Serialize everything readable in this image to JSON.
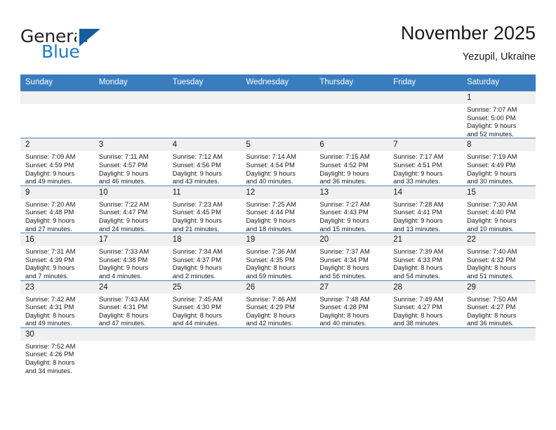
{
  "logo": {
    "text_top": "General",
    "text_bottom": "Blue",
    "icon": "triangle-flag-icon",
    "color_blue": "#1d7cc4",
    "color_dark": "#145d9e"
  },
  "header": {
    "month_title": "November 2025",
    "location": "Yezupil, Ukraine"
  },
  "theme": {
    "header_bg": "#3a7dbf",
    "daynum_bg": "#f0f0f0",
    "grid_line": "#4a86bd",
    "text": "#1a1a1a"
  },
  "weekday_headers": [
    "Sunday",
    "Monday",
    "Tuesday",
    "Wednesday",
    "Thursday",
    "Friday",
    "Saturday"
  ],
  "weeks": [
    [
      {
        "day": "",
        "blank": true,
        "sunrise": "",
        "sunset": "",
        "daylight_1": "",
        "daylight_2": ""
      },
      {
        "day": "",
        "blank": true,
        "sunrise": "",
        "sunset": "",
        "daylight_1": "",
        "daylight_2": ""
      },
      {
        "day": "",
        "blank": true,
        "sunrise": "",
        "sunset": "",
        "daylight_1": "",
        "daylight_2": ""
      },
      {
        "day": "",
        "blank": true,
        "sunrise": "",
        "sunset": "",
        "daylight_1": "",
        "daylight_2": ""
      },
      {
        "day": "",
        "blank": true,
        "sunrise": "",
        "sunset": "",
        "daylight_1": "",
        "daylight_2": ""
      },
      {
        "day": "",
        "blank": true,
        "sunrise": "",
        "sunset": "",
        "daylight_1": "",
        "daylight_2": ""
      },
      {
        "day": "1",
        "blank": false,
        "sunrise": "Sunrise: 7:07 AM",
        "sunset": "Sunset: 5:00 PM",
        "daylight_1": "Daylight: 9 hours",
        "daylight_2": "and 52 minutes."
      }
    ],
    [
      {
        "day": "2",
        "blank": false,
        "sunrise": "Sunrise: 7:09 AM",
        "sunset": "Sunset: 4:59 PM",
        "daylight_1": "Daylight: 9 hours",
        "daylight_2": "and 49 minutes."
      },
      {
        "day": "3",
        "blank": false,
        "sunrise": "Sunrise: 7:11 AM",
        "sunset": "Sunset: 4:57 PM",
        "daylight_1": "Daylight: 9 hours",
        "daylight_2": "and 46 minutes."
      },
      {
        "day": "4",
        "blank": false,
        "sunrise": "Sunrise: 7:12 AM",
        "sunset": "Sunset: 4:56 PM",
        "daylight_1": "Daylight: 9 hours",
        "daylight_2": "and 43 minutes."
      },
      {
        "day": "5",
        "blank": false,
        "sunrise": "Sunrise: 7:14 AM",
        "sunset": "Sunset: 4:54 PM",
        "daylight_1": "Daylight: 9 hours",
        "daylight_2": "and 40 minutes."
      },
      {
        "day": "6",
        "blank": false,
        "sunrise": "Sunrise: 7:15 AM",
        "sunset": "Sunset: 4:52 PM",
        "daylight_1": "Daylight: 9 hours",
        "daylight_2": "and 36 minutes."
      },
      {
        "day": "7",
        "blank": false,
        "sunrise": "Sunrise: 7:17 AM",
        "sunset": "Sunset: 4:51 PM",
        "daylight_1": "Daylight: 9 hours",
        "daylight_2": "and 33 minutes."
      },
      {
        "day": "8",
        "blank": false,
        "sunrise": "Sunrise: 7:19 AM",
        "sunset": "Sunset: 4:49 PM",
        "daylight_1": "Daylight: 9 hours",
        "daylight_2": "and 30 minutes."
      }
    ],
    [
      {
        "day": "9",
        "blank": false,
        "sunrise": "Sunrise: 7:20 AM",
        "sunset": "Sunset: 4:48 PM",
        "daylight_1": "Daylight: 9 hours",
        "daylight_2": "and 27 minutes."
      },
      {
        "day": "10",
        "blank": false,
        "sunrise": "Sunrise: 7:22 AM",
        "sunset": "Sunset: 4:47 PM",
        "daylight_1": "Daylight: 9 hours",
        "daylight_2": "and 24 minutes."
      },
      {
        "day": "11",
        "blank": false,
        "sunrise": "Sunrise: 7:23 AM",
        "sunset": "Sunset: 4:45 PM",
        "daylight_1": "Daylight: 9 hours",
        "daylight_2": "and 21 minutes."
      },
      {
        "day": "12",
        "blank": false,
        "sunrise": "Sunrise: 7:25 AM",
        "sunset": "Sunset: 4:44 PM",
        "daylight_1": "Daylight: 9 hours",
        "daylight_2": "and 18 minutes."
      },
      {
        "day": "13",
        "blank": false,
        "sunrise": "Sunrise: 7:27 AM",
        "sunset": "Sunset: 4:43 PM",
        "daylight_1": "Daylight: 9 hours",
        "daylight_2": "and 15 minutes."
      },
      {
        "day": "14",
        "blank": false,
        "sunrise": "Sunrise: 7:28 AM",
        "sunset": "Sunset: 4:41 PM",
        "daylight_1": "Daylight: 9 hours",
        "daylight_2": "and 13 minutes."
      },
      {
        "day": "15",
        "blank": false,
        "sunrise": "Sunrise: 7:30 AM",
        "sunset": "Sunset: 4:40 PM",
        "daylight_1": "Daylight: 9 hours",
        "daylight_2": "and 10 minutes."
      }
    ],
    [
      {
        "day": "16",
        "blank": false,
        "sunrise": "Sunrise: 7:31 AM",
        "sunset": "Sunset: 4:39 PM",
        "daylight_1": "Daylight: 9 hours",
        "daylight_2": "and 7 minutes."
      },
      {
        "day": "17",
        "blank": false,
        "sunrise": "Sunrise: 7:33 AM",
        "sunset": "Sunset: 4:38 PM",
        "daylight_1": "Daylight: 9 hours",
        "daylight_2": "and 4 minutes."
      },
      {
        "day": "18",
        "blank": false,
        "sunrise": "Sunrise: 7:34 AM",
        "sunset": "Sunset: 4:37 PM",
        "daylight_1": "Daylight: 9 hours",
        "daylight_2": "and 2 minutes."
      },
      {
        "day": "19",
        "blank": false,
        "sunrise": "Sunrise: 7:36 AM",
        "sunset": "Sunset: 4:35 PM",
        "daylight_1": "Daylight: 8 hours",
        "daylight_2": "and 59 minutes."
      },
      {
        "day": "20",
        "blank": false,
        "sunrise": "Sunrise: 7:37 AM",
        "sunset": "Sunset: 4:34 PM",
        "daylight_1": "Daylight: 8 hours",
        "daylight_2": "and 56 minutes."
      },
      {
        "day": "21",
        "blank": false,
        "sunrise": "Sunrise: 7:39 AM",
        "sunset": "Sunset: 4:33 PM",
        "daylight_1": "Daylight: 8 hours",
        "daylight_2": "and 54 minutes."
      },
      {
        "day": "22",
        "blank": false,
        "sunrise": "Sunrise: 7:40 AM",
        "sunset": "Sunset: 4:32 PM",
        "daylight_1": "Daylight: 8 hours",
        "daylight_2": "and 51 minutes."
      }
    ],
    [
      {
        "day": "23",
        "blank": false,
        "sunrise": "Sunrise: 7:42 AM",
        "sunset": "Sunset: 4:31 PM",
        "daylight_1": "Daylight: 8 hours",
        "daylight_2": "and 49 minutes."
      },
      {
        "day": "24",
        "blank": false,
        "sunrise": "Sunrise: 7:43 AM",
        "sunset": "Sunset: 4:31 PM",
        "daylight_1": "Daylight: 8 hours",
        "daylight_2": "and 47 minutes."
      },
      {
        "day": "25",
        "blank": false,
        "sunrise": "Sunrise: 7:45 AM",
        "sunset": "Sunset: 4:30 PM",
        "daylight_1": "Daylight: 8 hours",
        "daylight_2": "and 44 minutes."
      },
      {
        "day": "26",
        "blank": false,
        "sunrise": "Sunrise: 7:46 AM",
        "sunset": "Sunset: 4:29 PM",
        "daylight_1": "Daylight: 8 hours",
        "daylight_2": "and 42 minutes."
      },
      {
        "day": "27",
        "blank": false,
        "sunrise": "Sunrise: 7:48 AM",
        "sunset": "Sunset: 4:28 PM",
        "daylight_1": "Daylight: 8 hours",
        "daylight_2": "and 40 minutes."
      },
      {
        "day": "28",
        "blank": false,
        "sunrise": "Sunrise: 7:49 AM",
        "sunset": "Sunset: 4:27 PM",
        "daylight_1": "Daylight: 8 hours",
        "daylight_2": "and 38 minutes."
      },
      {
        "day": "29",
        "blank": false,
        "sunrise": "Sunrise: 7:50 AM",
        "sunset": "Sunset: 4:27 PM",
        "daylight_1": "Daylight: 8 hours",
        "daylight_2": "and 36 minutes."
      }
    ],
    [
      {
        "day": "30",
        "blank": false,
        "sunrise": "Sunrise: 7:52 AM",
        "sunset": "Sunset: 4:26 PM",
        "daylight_1": "Daylight: 8 hours",
        "daylight_2": "and 34 minutes."
      },
      {
        "day": "",
        "blank": true,
        "sunrise": "",
        "sunset": "",
        "daylight_1": "",
        "daylight_2": ""
      },
      {
        "day": "",
        "blank": true,
        "sunrise": "",
        "sunset": "",
        "daylight_1": "",
        "daylight_2": ""
      },
      {
        "day": "",
        "blank": true,
        "sunrise": "",
        "sunset": "",
        "daylight_1": "",
        "daylight_2": ""
      },
      {
        "day": "",
        "blank": true,
        "sunrise": "",
        "sunset": "",
        "daylight_1": "",
        "daylight_2": ""
      },
      {
        "day": "",
        "blank": true,
        "sunrise": "",
        "sunset": "",
        "daylight_1": "",
        "daylight_2": ""
      },
      {
        "day": "",
        "blank": true,
        "sunrise": "",
        "sunset": "",
        "daylight_1": "",
        "daylight_2": ""
      }
    ]
  ]
}
